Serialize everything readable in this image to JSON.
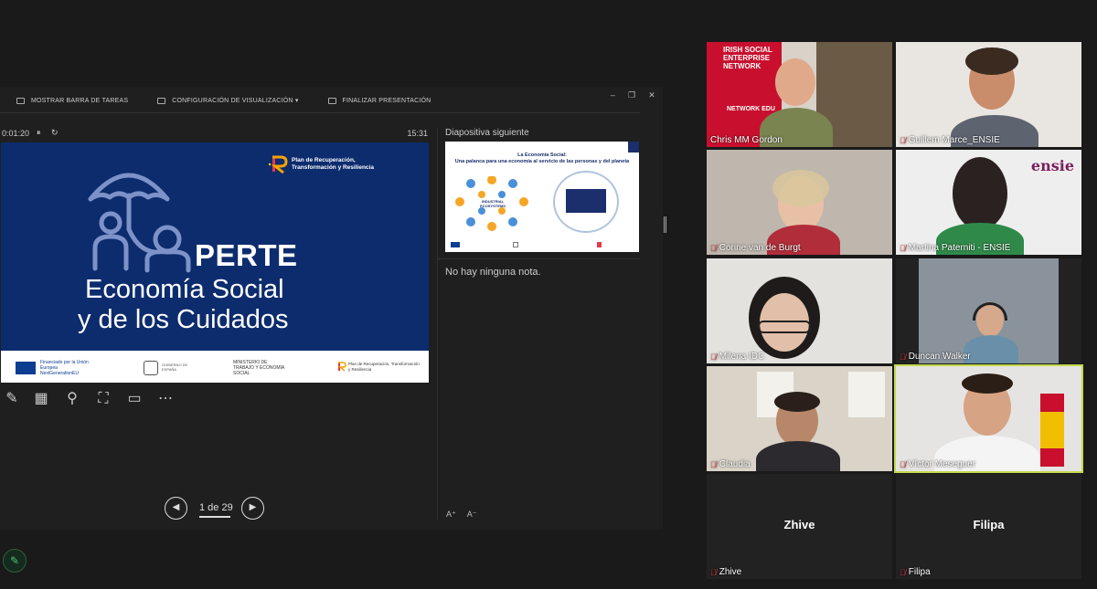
{
  "toolbar": {
    "taskbar": "MOSTRAR BARRA DE TAREAS",
    "display_settings": "CONFIGURACIÓN DE VISUALIZACIÓN ▾",
    "end_show": "FINALIZAR PRESENTACIÓN"
  },
  "window_controls": {
    "minimize": "–",
    "restore": "❐",
    "close": "✕"
  },
  "timer": {
    "elapsed": "0:01:20",
    "pause": "⏸",
    "reset": "↻",
    "clock": "15:31"
  },
  "slide": {
    "plan_name": "Plan de Recuperación, Transformación y Resiliencia",
    "title": "PERTE",
    "line1": "Economía Social",
    "line2": "y de los Cuidados",
    "logo_eu": "Financiado por la Unión Europea NextGenerationEU",
    "logo_gobierno": "GOBIERNO DE ESPAÑA",
    "logo_ministerio": "MINISTERIO DE TRABAJO Y ECONOMÍA SOCIAL",
    "logo_plan": "Plan de Recuperación, Transformación y Resiliencia"
  },
  "tools": {
    "pen": "✎",
    "grid": "▦",
    "zoom": "⚲",
    "pointer": "⛶",
    "subtitles": "▭",
    "more": "⋯"
  },
  "next_slide": {
    "label": "Diapositiva siguiente",
    "title": "La Economía Social:",
    "subtitle": "Una palanca para una economía al servicio de las personas y del planeta",
    "cluster_label": "INDUSTRIAL ECOSYSTEMS"
  },
  "notes": {
    "empty_text": "No hay ninguna nota."
  },
  "font_controls": {
    "increase": "A⁺",
    "decrease": "A⁻"
  },
  "navigation": {
    "prev": "◀",
    "next": "▶",
    "counter": "1 de 29",
    "progress": 0.0345
  },
  "pencil": "✎",
  "participants": [
    {
      "name": "Chris MM Gordon",
      "muted": false
    },
    {
      "name": "Guillem Marce_ENSIE",
      "muted": true
    },
    {
      "name": "Corine van de Burgt",
      "muted": true
    },
    {
      "name": "Martina Paterniti - ENSIE",
      "muted": true
    },
    {
      "name": "Milena IDC",
      "muted": true
    },
    {
      "name": "Duncan Walker",
      "muted": true
    },
    {
      "name": "Claudia",
      "muted": true
    },
    {
      "name": "Víctor Meseguer",
      "muted": true,
      "active": true
    },
    {
      "name": "Zhive",
      "muted": true,
      "avatar_text": "Zhive"
    },
    {
      "name": "Filipa",
      "muted": true,
      "avatar_text": "Filipa"
    }
  ],
  "background_text": {
    "irish": "IRISH SOCIAL ENTERPRISE NETWORK",
    "network_edu": "NETWORK EDU",
    "ensie": "ensie"
  },
  "mute_icon": "🎙̸",
  "colors": {
    "slide_blue": "#0d2c6e",
    "active_border": "#c3d94a",
    "mute_red": "#e23b3b"
  }
}
